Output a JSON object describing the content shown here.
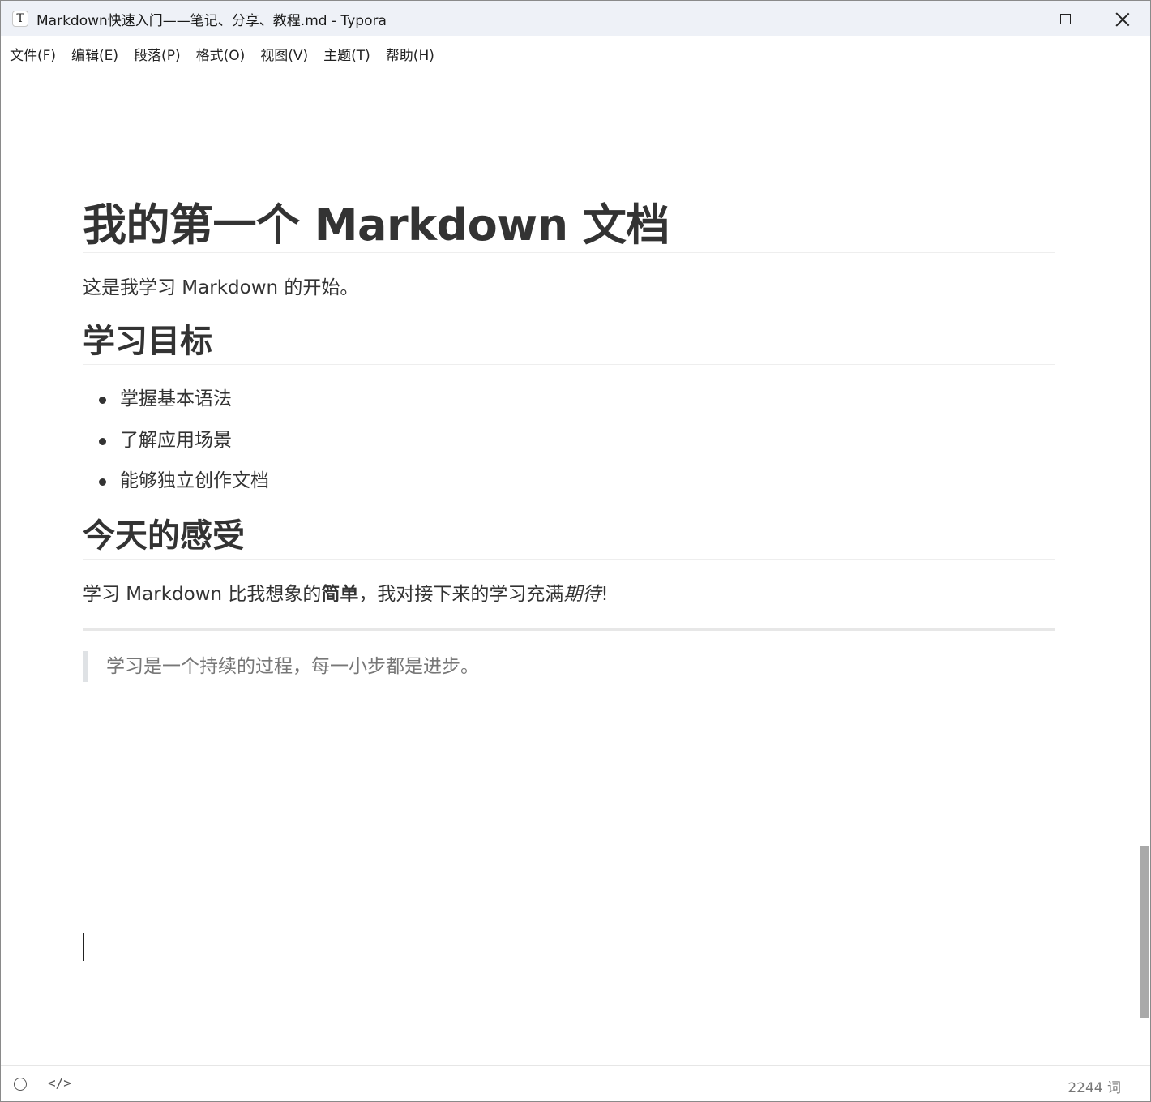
{
  "window": {
    "app_icon_glyph": "T",
    "title": "Markdown快速入门——笔记、分享、教程.md - Typora"
  },
  "menu": [
    {
      "label": "文件(F)"
    },
    {
      "label": "编辑(E)"
    },
    {
      "label": "段落(P)"
    },
    {
      "label": "格式(O)"
    },
    {
      "label": "视图(V)"
    },
    {
      "label": "主题(T)"
    },
    {
      "label": "帮助(H)"
    }
  ],
  "document": {
    "h1": "我的第一个 Markdown 文档",
    "intro": "这是我学习 Markdown 的开始。",
    "section1": {
      "heading": "学习目标",
      "items": [
        "掌握基本语法",
        "了解应用场景",
        "能够独立创作文档"
      ]
    },
    "section2": {
      "heading": "今天的感受",
      "text_before": "学习 Markdown 比我想象的",
      "bold_text": "简单",
      "text_middle": "，我对接下来的学习充满",
      "italic_text": "期待",
      "text_after": "!"
    },
    "blockquote": "学习是一个持续的过程，每一小步都是进步。"
  },
  "statusbar": {
    "outline_icon": "circle-icon",
    "source_glyph": "</>",
    "word_count": "2244 词"
  },
  "colors": {
    "titlebar_bg": "#eef1f7",
    "text": "#333333",
    "quote_text": "#777777",
    "quote_border": "#dfe2e5"
  }
}
